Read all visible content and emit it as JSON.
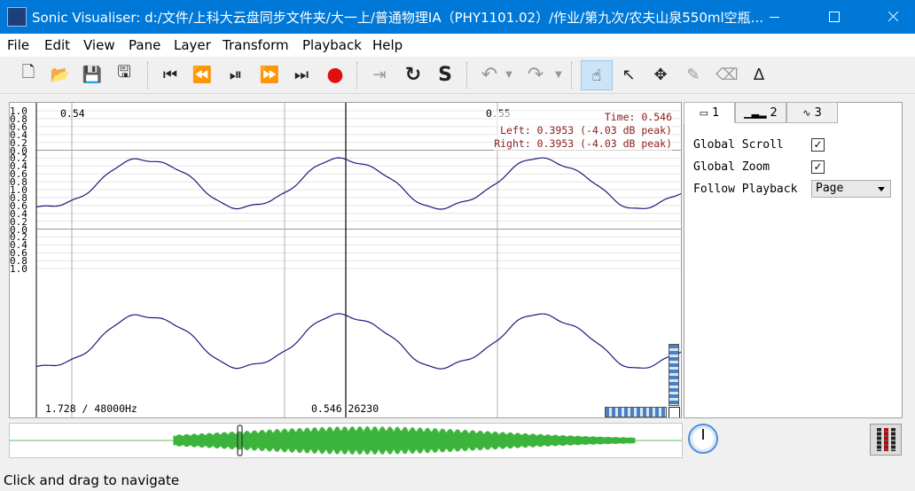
{
  "window": {
    "title": "Sonic Visualiser: d:/文件/上科大云盘同步文件夹/大一上/普通物理IA（PHY1101.02）/作业/第九次/农夫山泉550ml空瓶...",
    "minimize_icon": "minimize-icon",
    "maximize_icon": "maximize-icon",
    "close_icon": "close-icon"
  },
  "menu": [
    "File",
    "Edit",
    "View",
    "Pane",
    "Layer",
    "Transform",
    "Playback",
    "Help"
  ],
  "toolbar": {
    "new": "🗋",
    "open": "📂",
    "save": "💾",
    "save_as": "🖫",
    "rewind_start": "⏮",
    "rewind": "⏪",
    "play_pause": "⏯",
    "ffwd": "⏩",
    "ffwd_end": "⏭",
    "record": "●",
    "play_selection": "⇥",
    "loop": "↻",
    "solo": "S",
    "undo": "↶",
    "redo": "↷",
    "navigate": "☝",
    "select": "↖",
    "move": "✥",
    "draw": "✎",
    "erase": "⌫",
    "measure": "∆"
  },
  "pane": {
    "scale_labels": [
      "1.0",
      "0.8",
      "0.6",
      "0.4",
      "0.2",
      "0.0",
      "0.2",
      "0.4",
      "0.6",
      "0.8",
      "1.0",
      "0.8",
      "0.6",
      "0.4",
      "0.2",
      "0.0",
      "0.2",
      "0.4",
      "0.6",
      "0.8",
      "1.0"
    ],
    "time_marks": [
      "0.54",
      "0.55"
    ],
    "readout": {
      "time": "Time: 0.546",
      "left": "Left: 0.3953 (-4.03 dB peak)",
      "right": "Right: 0.3953 (-4.03 dB peak)"
    },
    "bottom_left": "1.728 / 48000Hz",
    "bottom_center": "0.546 26230",
    "waveform_color": "#1a1a7a",
    "overview_color": "#3cb43c"
  },
  "panel": {
    "tabs": [
      {
        "label": "1",
        "icon": "pane-icon"
      },
      {
        "label": "2",
        "icon": "spectrum-icon"
      },
      {
        "label": "3",
        "icon": "waveform-icon"
      }
    ],
    "global_scroll": "Global Scroll",
    "global_zoom": "Global Zoom",
    "follow_playback": "Follow Playback",
    "follow_value": "Page",
    "check": "✓"
  },
  "status": "Click and drag to navigate"
}
